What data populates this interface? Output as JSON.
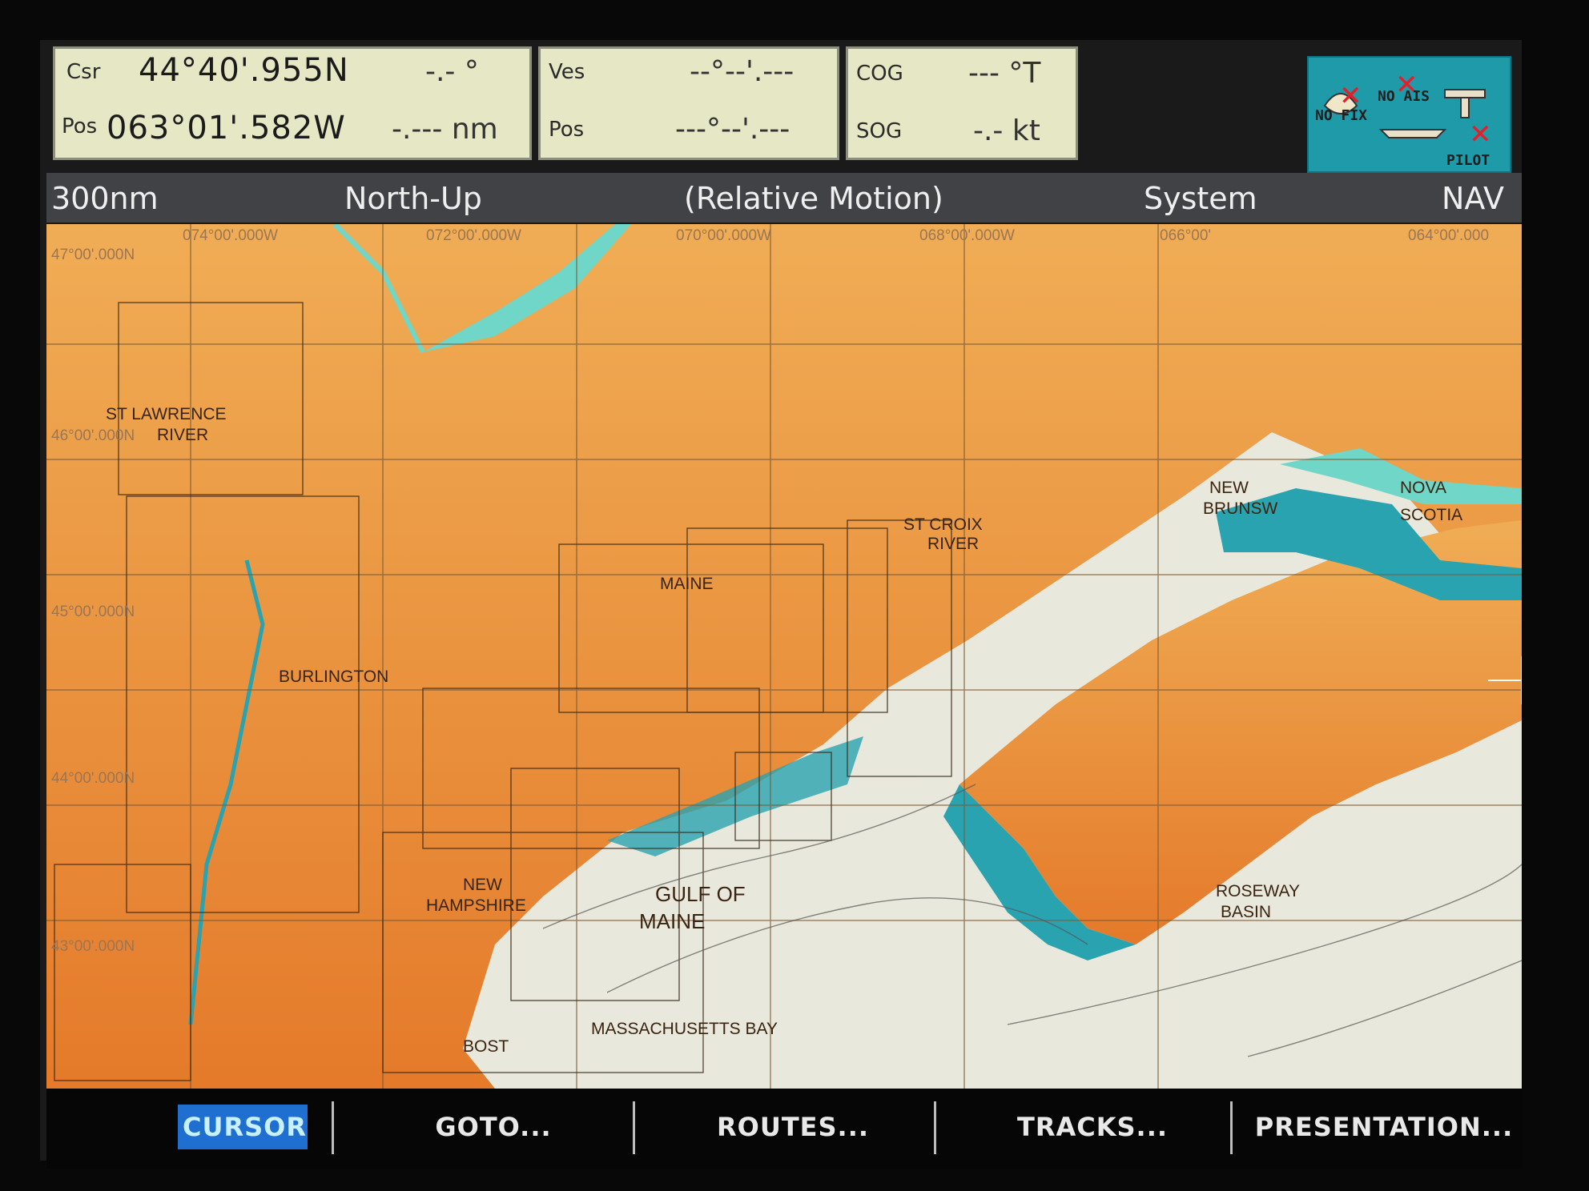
{
  "cursor_panel": {
    "csr_label": "Csr",
    "pos_label": "Pos",
    "lat": "44°40'.955N",
    "lon": "063°01'.582W",
    "bearing": "-.- °",
    "range": "-.--- nm"
  },
  "vessel_panel": {
    "ves_label": "Ves",
    "pos_label": "Pos",
    "lat": "--°--'.---",
    "lon": "---°--'.---"
  },
  "course_panel": {
    "cog_label": "COG",
    "sog_label": "SOG",
    "cog": "--- °T",
    "sog": "-.- kt"
  },
  "status": {
    "no_fix": "NO FIX",
    "no_ais": "NO AIS",
    "pilot": "PILOT"
  },
  "info_bar": {
    "range": "300nm",
    "orientation": "North-Up",
    "motion": "(Relative Motion)",
    "datum": "System",
    "mode": "NAV"
  },
  "grid": {
    "lon_labels": [
      "074°00'.000W",
      "072°00'.000W",
      "070°00'.000W",
      "068°00'.000W",
      "066°00'",
      "064°00'.000"
    ],
    "lat_labels": [
      "47°00'.000N",
      "46°00'.000N",
      "45°00'.000N",
      "44°00'.000N",
      "43°00'.000N"
    ]
  },
  "places": {
    "st_lawrence": "ST LAWRENCE",
    "river": "RIVER",
    "burlington": "BURLINGTON",
    "maine": "MAINE",
    "st_croix": "ST CROIX",
    "st_croix_river": "RIVER",
    "new_brunswick": "NEW",
    "new_brunswick2": "BRUNSW",
    "nova": "NOVA",
    "scotia": "SCOTIA",
    "new_hampshire": "NEW",
    "new_hampshire2": "HAMPSHIRE",
    "gulf": "GULF OF",
    "gulf2": "MAINE",
    "roseway": "ROSEWAY",
    "basin": "BASIN",
    "mass_bay": "MASSACHUSETTS BAY",
    "boston": "BOST"
  },
  "softkeys": {
    "cursor": "CURSOR",
    "goto": "GOTO...",
    "routes": "ROUTES...",
    "tracks": "TRACKS...",
    "presentation": "PRESENTATION..."
  },
  "colors": {
    "land": "#e8953a",
    "sea": "#e9e8dc",
    "shallow": "#2aa3b0",
    "shoal": "#6fd6c8"
  }
}
